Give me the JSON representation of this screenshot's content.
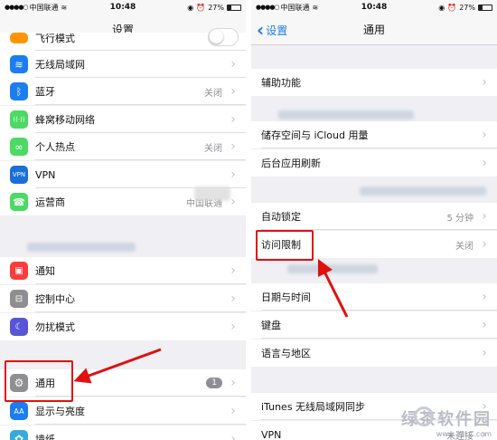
{
  "left": {
    "status": {
      "carrier": "中国联通",
      "time": "10:48",
      "battery": "27%",
      "battery_level": 0.27
    },
    "title": "设置",
    "partial_row": {
      "label": "飞行模式"
    },
    "group1": [
      {
        "label": "无线局域网",
        "value": "",
        "icon": "wifi-icon",
        "color": "#1a7ef0",
        "glyph": "≋"
      },
      {
        "label": "蓝牙",
        "value": "关闭",
        "icon": "bluetooth-icon",
        "color": "#1a7ef0",
        "glyph": "ᛒ"
      },
      {
        "label": "蜂窝移动网络",
        "value": "",
        "icon": "cellular-icon",
        "color": "#4cd964",
        "glyph": "((·))"
      },
      {
        "label": "个人热点",
        "value": "关闭",
        "icon": "hotspot-icon",
        "color": "#4cd964",
        "glyph": "∞"
      },
      {
        "label": "VPN",
        "value": "",
        "icon": "vpn-icon",
        "color": "#1a6fd8",
        "glyph": "VPN"
      },
      {
        "label": "运营商",
        "value": "中国联通",
        "icon": "phone-icon",
        "color": "#4cd964",
        "glyph": "☎"
      }
    ],
    "group2": [
      {
        "label": "通知",
        "icon": "notification-icon",
        "color": "#fc3d39",
        "glyph": "▣"
      },
      {
        "label": "控制中心",
        "icon": "control-center-icon",
        "color": "#8e8e93",
        "glyph": "⊟"
      },
      {
        "label": "勿扰模式",
        "icon": "moon-icon",
        "color": "#5856d6",
        "glyph": "☾"
      }
    ],
    "group3": [
      {
        "label": "通用",
        "badge": "1",
        "icon": "gear-icon",
        "color": "#8e8e93",
        "glyph": "⚙"
      },
      {
        "label": "显示与亮度",
        "icon": "display-icon",
        "color": "#1a7ef0",
        "glyph": "AA"
      },
      {
        "label": "墙纸",
        "icon": "wallpaper-icon",
        "color": "#36aadc",
        "glyph": "✿"
      }
    ]
  },
  "right": {
    "status": {
      "carrier": "中国联通",
      "time": "10:48",
      "battery": "27%",
      "battery_level": 0.27
    },
    "back_label": "设置",
    "title": "通用",
    "rows": [
      {
        "label": "辅助功能",
        "value": ""
      },
      {
        "label": "储存空间与 iCloud 用量",
        "value": ""
      },
      {
        "label": "后台应用刷新",
        "value": ""
      },
      {
        "label": "自动锁定",
        "value": "5 分钟"
      },
      {
        "label": "访问限制",
        "value": "关闭"
      },
      {
        "label": "日期与时间",
        "value": ""
      },
      {
        "label": "键盘",
        "value": ""
      },
      {
        "label": "语言与地区",
        "value": ""
      },
      {
        "label": "iTunes 无线局域网同步",
        "value": ""
      },
      {
        "label": "VPN",
        "value": "未连接"
      }
    ]
  },
  "watermark": {
    "cn": "绿茶软件园",
    "url": "www.33LC.com"
  },
  "colors": {
    "accent": "#1a7ef0",
    "highlight": "#e01010",
    "background": "#efeff4"
  }
}
